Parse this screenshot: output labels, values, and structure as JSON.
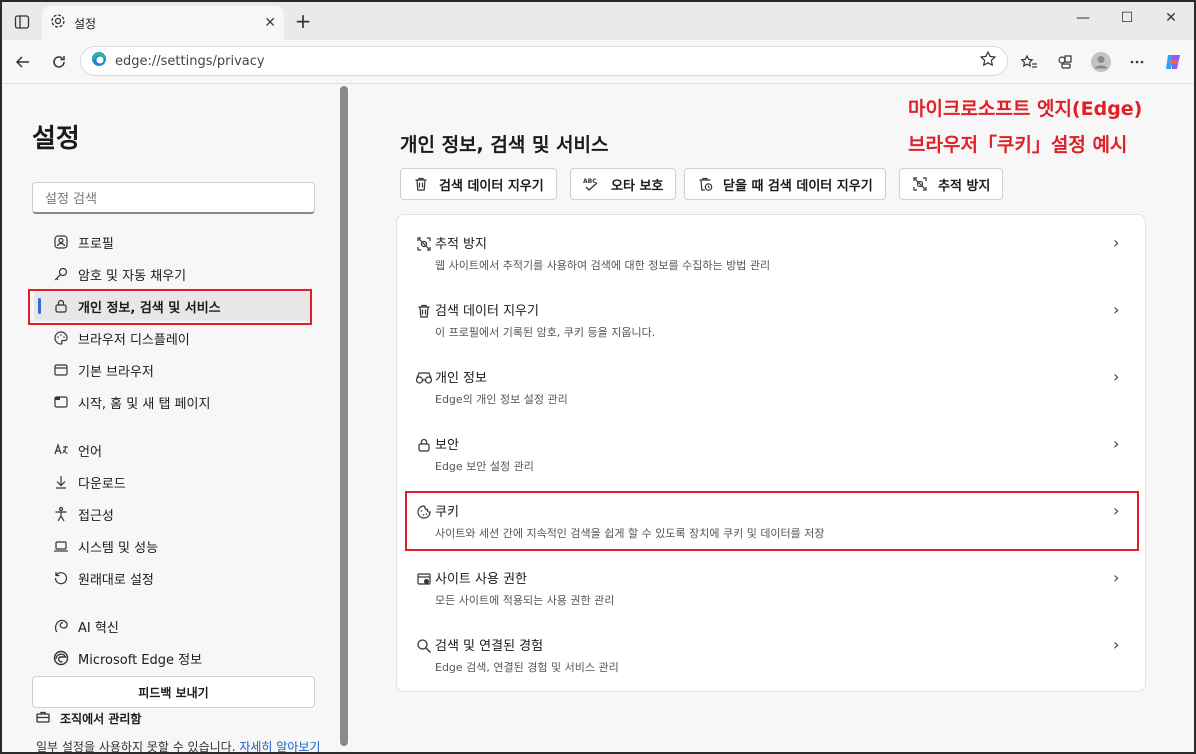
{
  "browser": {
    "tab_title": "설정",
    "tab_close": "✕",
    "new_tab": "+",
    "window_controls": [
      "—",
      "☐",
      "✕"
    ],
    "url": "edge://settings/privacy"
  },
  "sidebar": {
    "title": "설정",
    "search_placeholder": "설정 검색",
    "items": [
      {
        "label": "프로필",
        "icon": "profile-icon"
      },
      {
        "label": "암호 및 자동 채우기",
        "icon": "key-icon"
      },
      {
        "label": "개인 정보, 검색 및 서비스",
        "icon": "lock-icon",
        "active": true
      },
      {
        "label": "브라우저 디스플레이",
        "icon": "palette-icon"
      },
      {
        "label": "기본 브라우저",
        "icon": "browser-icon"
      },
      {
        "label": "시작, 홈 및 새 탭 페이지",
        "icon": "home-tab-icon"
      },
      {
        "label": "언어",
        "icon": "language-icon"
      },
      {
        "label": "다운로드",
        "icon": "download-icon"
      },
      {
        "label": "접근성",
        "icon": "accessibility-icon"
      },
      {
        "label": "시스템 및 성능",
        "icon": "laptop-icon"
      },
      {
        "label": "원래대로 설정",
        "icon": "reset-icon"
      },
      {
        "label": "AI 혁신",
        "icon": "ai-icon"
      },
      {
        "label": "Microsoft Edge 정보",
        "icon": "edge-icon"
      }
    ],
    "feedback_label": "피드백 보내기",
    "managed_label": "조직에서 관리함",
    "note_text": "일부 설정을 사용하지 못할 수 있습니다. ",
    "note_link": "자세히 알아보기"
  },
  "main": {
    "title": "개인 정보, 검색 및 서비스",
    "chips": [
      {
        "label": "검색 데이터 지우기",
        "icon": "trash-icon"
      },
      {
        "label": "오타 보호",
        "icon": "spellcheck-icon"
      },
      {
        "label": "닫을 때 검색 데이터 지우기",
        "icon": "trash-clock-icon"
      },
      {
        "label": "추적 방지",
        "icon": "tracking-icon"
      }
    ],
    "rows": [
      {
        "title": "추적 방지",
        "desc": "웹 사이트에서 추적기를 사용하여 검색에 대한 정보를 수집하는 방법 관리",
        "icon": "tracking-icon"
      },
      {
        "title": "검색 데이터 지우기",
        "desc": "이 프로필에서 기록된 암호, 쿠키 등을 지웁니다.",
        "icon": "trash-icon"
      },
      {
        "title": "개인 정보",
        "desc": "Edge의 개인 정보 설정 관리",
        "icon": "glasses-icon"
      },
      {
        "title": "보안",
        "desc": "Edge 보안 설정 관리",
        "icon": "lock-icon"
      },
      {
        "title": "쿠키",
        "desc": "사이트와 세션 간에 지속적인 검색을 쉽게 할 수 있도록 장치에 쿠키 및 데이터를 저장",
        "icon": "cookie-icon"
      },
      {
        "title": "사이트 사용 권한",
        "desc": "모든 사이트에 적용되는 사용 권한 관리",
        "icon": "site-permissions-icon"
      },
      {
        "title": "검색 및 연결된 경험",
        "desc": "Edge 검색, 연결된 경험 및 서비스 관리",
        "icon": "search-icon"
      }
    ]
  },
  "annotation": {
    "line1": "마이크로소프트 엣지(Edge)",
    "line2": "브라우저「쿠키」설정 예시",
    "color": "#e01f26"
  }
}
